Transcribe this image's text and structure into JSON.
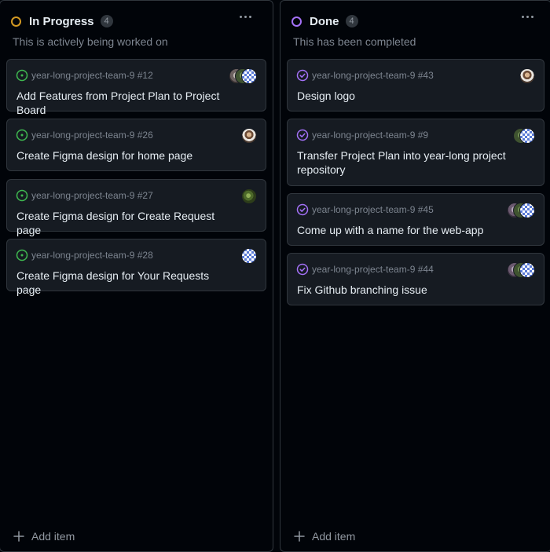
{
  "colors": {
    "background": "#010409",
    "card_bg": "#161b22",
    "border": "#30363d",
    "in_progress_status": "#d29922",
    "done_status": "#a371f7",
    "open_issue": "#3fb950",
    "closed_issue": "#a371f7",
    "muted_text": "#7d8590"
  },
  "columns": [
    {
      "title": "In Progress",
      "count": "4",
      "description": "This is actively being worked on",
      "status_icon": "circle-outline-icon",
      "add_item_label": "Add item",
      "cards": [
        {
          "ref": "year-long-project-team-9 #12",
          "title": "Add Features from Project Plan to Project Board",
          "issue_state": "open-issue-icon",
          "avatars": [
            "gray-avatar",
            "green-avatar",
            "checker-avatar"
          ]
        },
        {
          "ref": "year-long-project-team-9 #26",
          "title": "Create Figma design for home page",
          "issue_state": "open-issue-icon",
          "avatars": [
            "face-avatar"
          ]
        },
        {
          "ref": "year-long-project-team-9 #27",
          "title": "Create Figma design for Create Request page",
          "issue_state": "open-issue-icon",
          "avatars": [
            "plant-avatar"
          ]
        },
        {
          "ref": "year-long-project-team-9 #28",
          "title": "Create Figma design for Your Requests page",
          "issue_state": "open-issue-icon",
          "avatars": [
            "checker-avatar"
          ]
        }
      ]
    },
    {
      "title": "Done",
      "count": "4",
      "description": "This has been completed",
      "status_icon": "circle-outline-icon",
      "add_item_label": "Add item",
      "cards": [
        {
          "ref": "year-long-project-team-9 #43",
          "title": "Design logo",
          "issue_state": "closed-issue-icon",
          "avatars": [
            "face-avatar"
          ]
        },
        {
          "ref": "year-long-project-team-9 #9",
          "title": "Transfer Project Plan into year-long project repository",
          "issue_state": "closed-issue-icon",
          "avatars": [
            "green-avatar",
            "checker-avatar"
          ]
        },
        {
          "ref": "year-long-project-team-9 #45",
          "title": "Come up with a name for the web-app",
          "issue_state": "closed-issue-icon",
          "avatars": [
            "purple-avatar",
            "green-avatar",
            "checker-avatar"
          ]
        },
        {
          "ref": "year-long-project-team-9 #44",
          "title": "Fix Github branching issue",
          "issue_state": "closed-issue-icon",
          "avatars": [
            "purple-avatar",
            "green-avatar",
            "checker-avatar"
          ]
        }
      ]
    }
  ]
}
